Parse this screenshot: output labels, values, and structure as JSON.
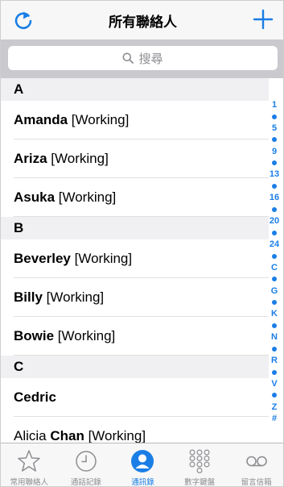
{
  "nav": {
    "title": "所有聯絡人"
  },
  "search": {
    "placeholder": "搜尋"
  },
  "sections": [
    {
      "letter": "A",
      "contacts": [
        {
          "bold": "Amanda",
          "rest": " [Working]"
        },
        {
          "bold": "Ariza",
          "rest": " [Working]"
        },
        {
          "bold": "Asuka",
          "rest": " [Working]"
        }
      ]
    },
    {
      "letter": "B",
      "contacts": [
        {
          "bold": "Beverley",
          "rest": " [Working]"
        },
        {
          "bold": "Billy",
          "rest": " [Working]"
        },
        {
          "bold": "Bowie",
          "rest": " [Working]"
        }
      ]
    },
    {
      "letter": "C",
      "contacts": [
        {
          "bold": "Cedric",
          "rest": ""
        },
        {
          "pre": "Alicia ",
          "bold": "Chan",
          "rest": " [Working]"
        }
      ]
    }
  ],
  "index": [
    "1",
    "•",
    "5",
    "•",
    "9",
    "•",
    "13",
    "•",
    "16",
    "•",
    "20",
    "•",
    "24",
    "•",
    "C",
    "•",
    "G",
    "•",
    "K",
    "•",
    "N",
    "•",
    "R",
    "•",
    "V",
    "•",
    "Z",
    "#"
  ],
  "tabs": [
    {
      "label": "常用聯絡人",
      "icon": "star-icon",
      "active": false
    },
    {
      "label": "通話記錄",
      "icon": "clock-icon",
      "active": false
    },
    {
      "label": "通訊錄",
      "icon": "person-icon",
      "active": true
    },
    {
      "label": "數字鍵盤",
      "icon": "keypad-icon",
      "active": false
    },
    {
      "label": "留言信箱",
      "icon": "voicemail-icon",
      "active": false
    }
  ],
  "colors": {
    "accent": "#1a7ee6",
    "inactive": "#8e8e93",
    "search_bg": "#c9c9ce",
    "section_bg": "#f0f0f2"
  }
}
